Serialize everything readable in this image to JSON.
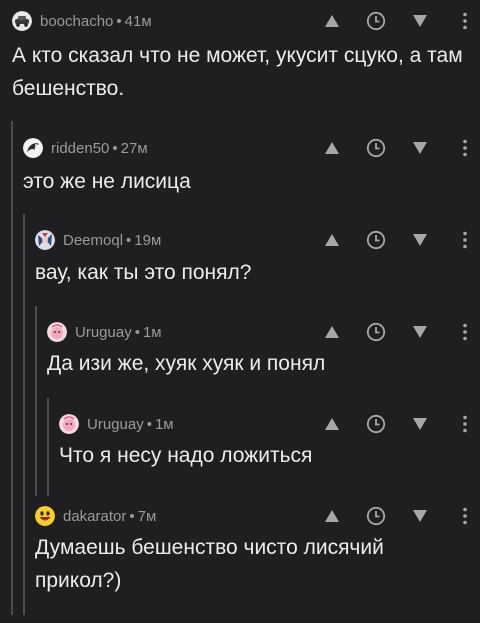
{
  "colors": {
    "background": "#1f1f21",
    "text": "#ececec",
    "meta": "#9a9a9d",
    "thread_line": "#4d4d50",
    "icon": "#a7a7aa"
  },
  "comments": [
    {
      "author": "boochacho",
      "time": "41м",
      "text": "А кто сказал что не может, укусит сцуко, а там бешенство.",
      "avatar_icon": "car-avatar"
    },
    {
      "author": "ridden50",
      "time": "27м",
      "text": "это же не лисица",
      "avatar_icon": "dragon-avatar"
    },
    {
      "author": "Deemoql",
      "time": "19м",
      "text": "вау, как ты это понял?",
      "avatar_icon": "anime-avatar"
    },
    {
      "author": "Uruguay",
      "time": "1м",
      "text": "Да изи же, хуяк хуяк и понял",
      "avatar_icon": "pink-avatar"
    },
    {
      "author": "Uruguay",
      "time": "1м",
      "text": "Что я несу надо ложиться",
      "avatar_icon": "pink-avatar"
    },
    {
      "author": "dakarator",
      "time": "7м",
      "text": "Думаешь бешенство чисто лисячий прикол?)",
      "avatar_icon": "smiley-avatar"
    }
  ],
  "meta_separator": "•"
}
